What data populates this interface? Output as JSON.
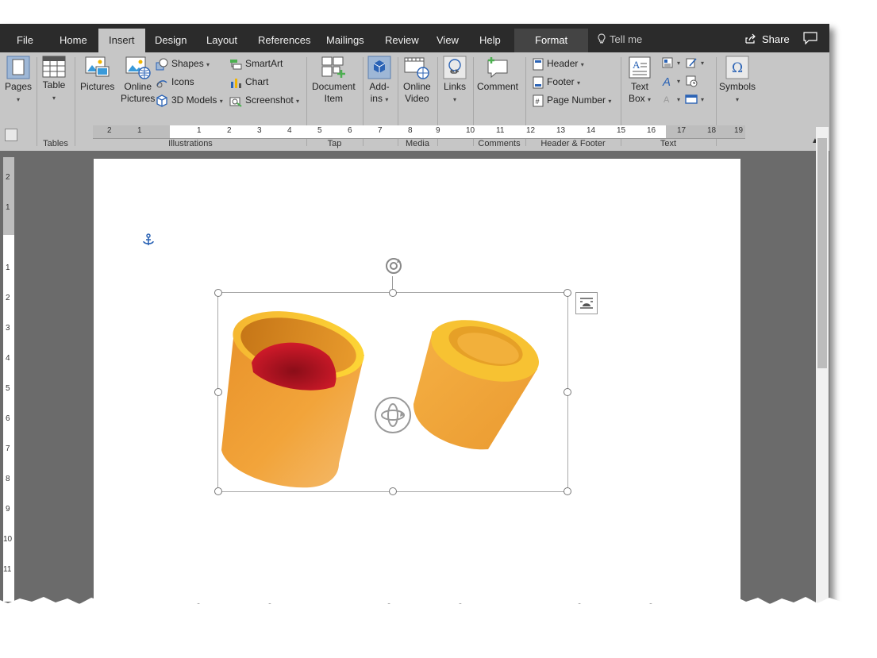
{
  "tabs": [
    "File",
    "Home",
    "Insert",
    "Design",
    "Layout",
    "References",
    "Mailings",
    "Review",
    "View",
    "Help"
  ],
  "active_tab": "Insert",
  "context_tab": "Format",
  "tell_me": "Tell me",
  "share": "Share",
  "ribbon": {
    "pages": {
      "label": "Pages"
    },
    "tables": {
      "table": "Table",
      "group": "Tables"
    },
    "illustrations": {
      "pictures": "Pictures",
      "online_pictures_1": "Online",
      "online_pictures_2": "Pictures",
      "shapes": "Shapes",
      "icons": "Icons",
      "models3d": "3D Models",
      "smartart": "SmartArt",
      "chart": "Chart",
      "screenshot": "Screenshot",
      "group": "Illustrations"
    },
    "tap": {
      "doc_item_1": "Document",
      "doc_item_2": "Item",
      "group": "Tap"
    },
    "addins": {
      "label_1": "Add-",
      "label_2": "ins"
    },
    "media": {
      "online_video_1": "Online",
      "online_video_2": "Video",
      "group": "Media"
    },
    "links": {
      "label": "Links"
    },
    "comments": {
      "comment": "Comment",
      "group": "Comments"
    },
    "header_footer": {
      "header": "Header",
      "footer": "Footer",
      "page_number": "Page Number",
      "group": "Header & Footer"
    },
    "text": {
      "text_box_1": "Text",
      "text_box_2": "Box",
      "group": "Text"
    },
    "symbols": {
      "label": "Symbols"
    }
  },
  "ruler_h": [
    "2",
    "1",
    "1",
    "2",
    "3",
    "4",
    "5",
    "6",
    "7",
    "8",
    "9",
    "10",
    "11",
    "12",
    "13",
    "14",
    "15",
    "16",
    "17",
    "18",
    "19"
  ],
  "ruler_v": [
    "2",
    "1",
    "1",
    "2",
    "3",
    "4",
    "5",
    "6",
    "7",
    "8",
    "9",
    "10",
    "11"
  ],
  "colors": {
    "tabbar": "#2b2b2b",
    "ribbon": "#c6c6c6",
    "workspace": "#6b6b6b",
    "model_orange": "#f2a43a",
    "model_red": "#c8102e",
    "accent_blue": "#2b63b5"
  }
}
